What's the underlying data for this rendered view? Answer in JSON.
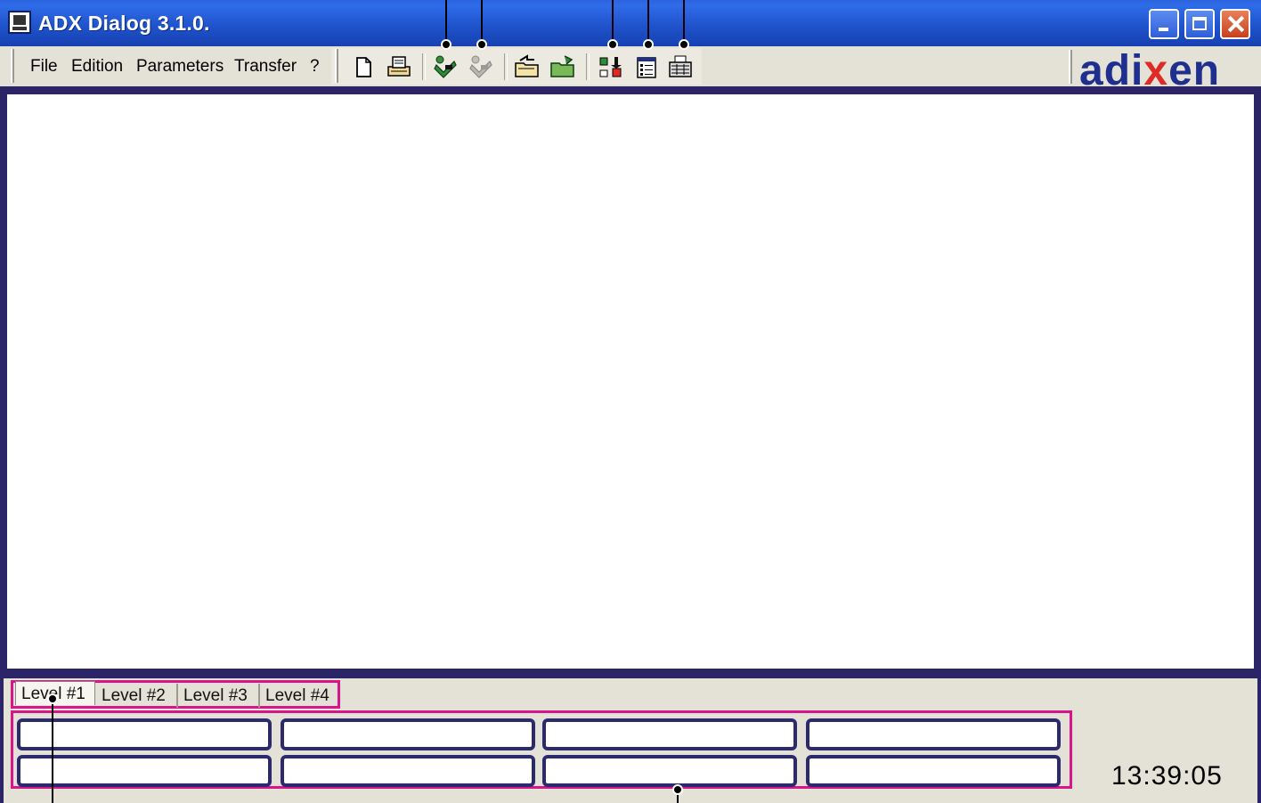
{
  "window": {
    "title": "ADX Dialog 3.1.0."
  },
  "menu": {
    "items": [
      "File",
      "Edition",
      "Parameters",
      "Transfer",
      "?"
    ]
  },
  "toolbar": {
    "buttons": [
      "new-document-icon",
      "print-icon",
      "connect-icon",
      "disconnect-icon",
      "open-folder-icon",
      "save-folder-icon",
      "transfer-icon",
      "list-icon",
      "keyboard-icon"
    ]
  },
  "brand": {
    "logo_left": "adi",
    "logo_x": "x",
    "logo_right": "en",
    "color_blue": "#1f2f8f",
    "color_red": "#e02a26"
  },
  "levels": {
    "tabs": [
      "Level #1",
      "Level #2",
      "Level #3",
      "Level #4"
    ],
    "active": "Level #1"
  },
  "status": {
    "clock": "13:39:05"
  },
  "colors": {
    "frame": "#2b2466",
    "highlight": "#d8158a"
  }
}
